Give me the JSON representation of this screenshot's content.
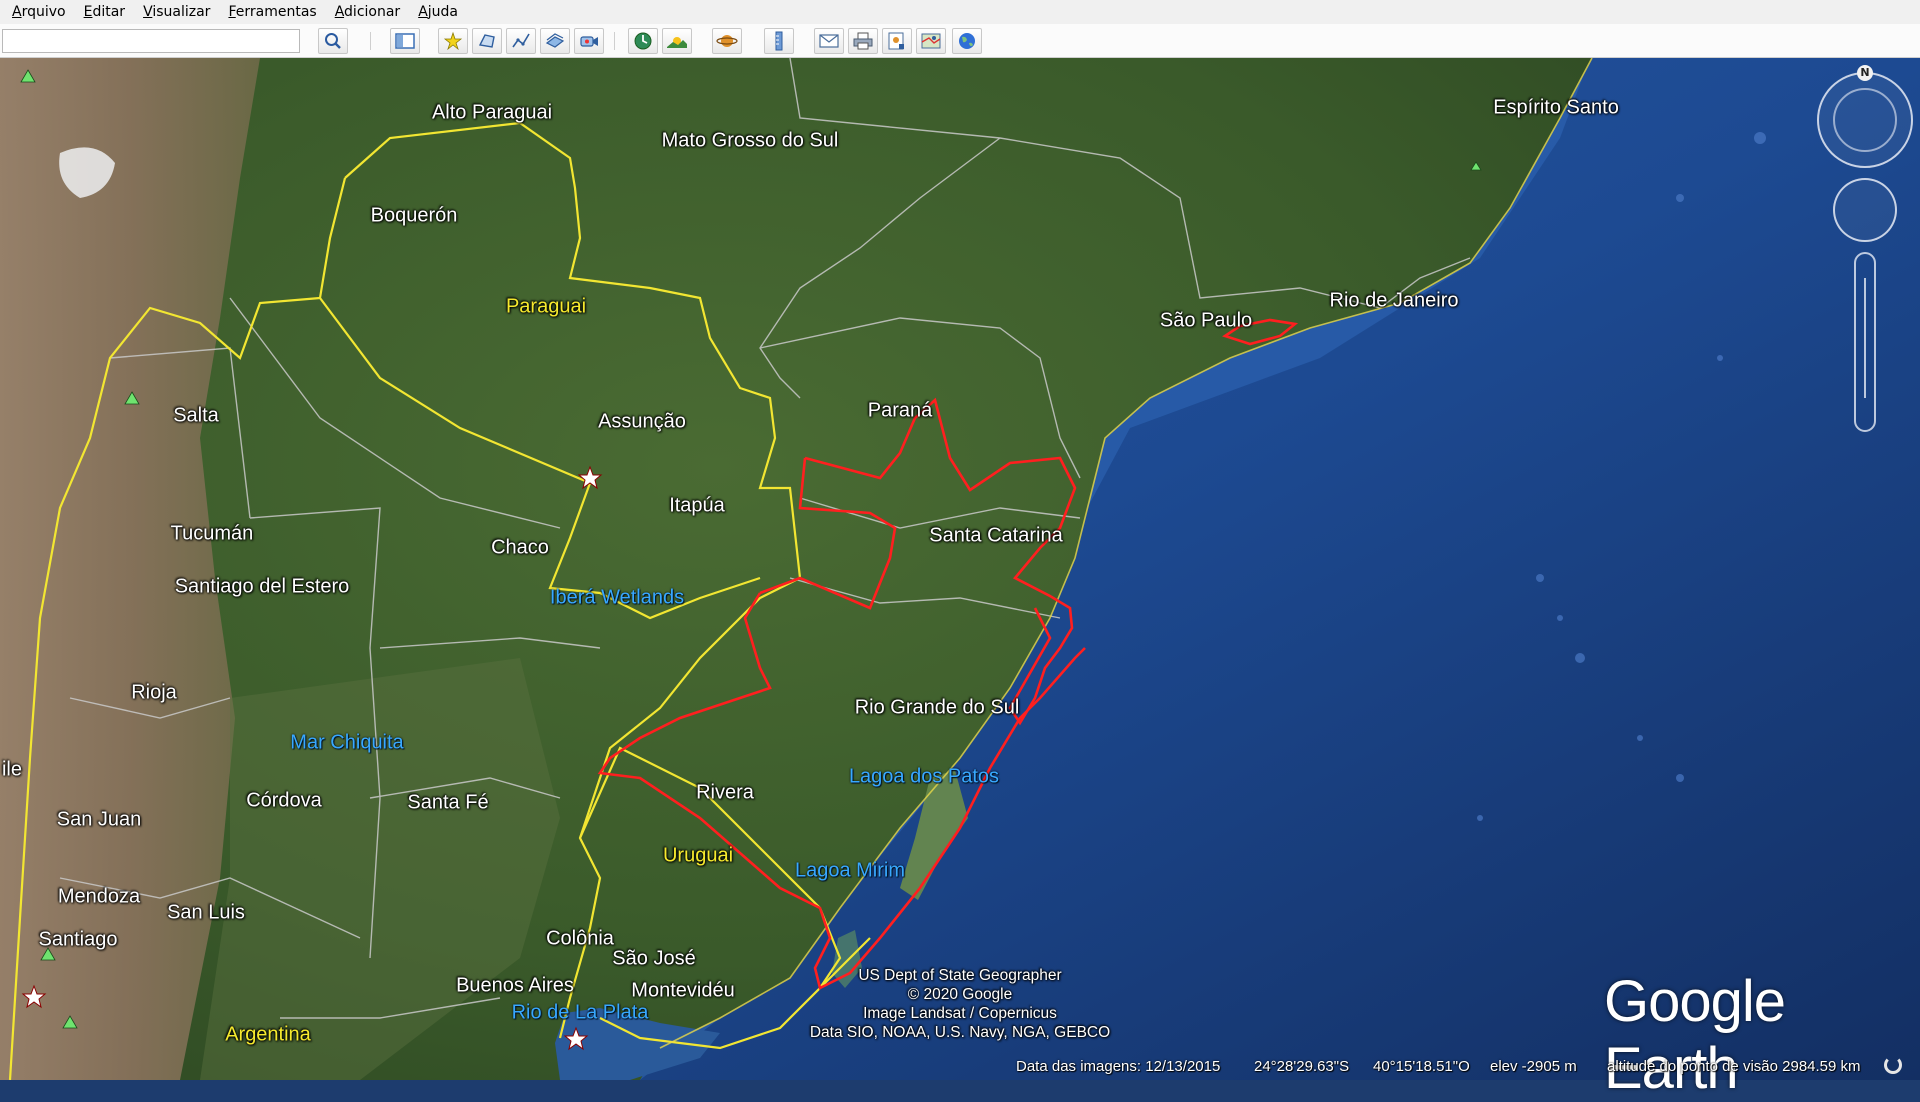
{
  "menu": {
    "items": [
      "Arquivo",
      "Editar",
      "Visualizar",
      "Ferramentas",
      "Adicionar",
      "Ajuda"
    ]
  },
  "toolbar": {
    "search_value": "",
    "search_placeholder": "",
    "buttons": [
      "search-icon",
      "sidebar-toggle-icon",
      "placemark-icon",
      "polygon-icon",
      "path-icon",
      "image-overlay-icon",
      "record-tour-icon",
      "historical-imagery-icon",
      "sunlight-icon",
      "planets-icon",
      "ruler-icon",
      "email-icon",
      "print-icon",
      "save-image-icon",
      "view-in-maps-icon",
      "earth-icon"
    ]
  },
  "colors": {
    "country_border": "#f2e632",
    "state_border": "#c9c9c9",
    "highlight_polygon": "#ff1f1f",
    "ocean": "#1f4f9a",
    "land": "#3a5a2a"
  },
  "map": {
    "countries": [
      {
        "id": "alto-paraguai",
        "text": "Alto Paraguai"
      },
      {
        "id": "boqueron",
        "text": "Boquerón"
      },
      {
        "id": "paraguai",
        "text": "Paraguai"
      },
      {
        "id": "uruguai",
        "text": "Uruguai"
      },
      {
        "id": "argentina",
        "text": "Argentina"
      }
    ],
    "places": [
      {
        "id": "mato-grosso-do-sul",
        "text": "Mato Grosso do Sul"
      },
      {
        "id": "espirito-santo",
        "text": "Espírito Santo"
      },
      {
        "id": "sao-paulo",
        "text": "São Paulo"
      },
      {
        "id": "rio-de-janeiro",
        "text": "Rio de Janeiro"
      },
      {
        "id": "parana",
        "text": "Paraná"
      },
      {
        "id": "assuncao",
        "text": "Assunção"
      },
      {
        "id": "salta",
        "text": "Salta"
      },
      {
        "id": "itapua",
        "text": "Itapúa"
      },
      {
        "id": "santa-catarina",
        "text": "Santa Catarina"
      },
      {
        "id": "chaco",
        "text": "Chaco"
      },
      {
        "id": "tucuman",
        "text": "Tucumán"
      },
      {
        "id": "santiago-del-estero",
        "text": "Santiago del Estero"
      },
      {
        "id": "rioja",
        "text": "Rioja"
      },
      {
        "id": "rio-grande-do-sul",
        "text": "Rio Grande do Sul"
      },
      {
        "id": "cordoba",
        "text": "Córdova"
      },
      {
        "id": "santa-fe",
        "text": "Santa Fé"
      },
      {
        "id": "rivera",
        "text": "Rivera"
      },
      {
        "id": "san-juan",
        "text": "San Juan"
      },
      {
        "id": "mendoza",
        "text": "Mendoza"
      },
      {
        "id": "san-luis",
        "text": "San Luis"
      },
      {
        "id": "santiago",
        "text": "Santiago"
      },
      {
        "id": "colonia",
        "text": "Colônia"
      },
      {
        "id": "sao-jose",
        "text": "São José"
      },
      {
        "id": "buenos-aires",
        "text": "Buenos Aires"
      },
      {
        "id": "montevideu",
        "text": "Montevidéu"
      },
      {
        "id": "chile-partial",
        "text": "ile"
      }
    ],
    "water": [
      {
        "id": "ibera-wetlands",
        "text": "Iberá Wetlands"
      },
      {
        "id": "mar-chiquita",
        "text": "Mar Chiquita"
      },
      {
        "id": "lagoa-dos-patos",
        "text": "Lagoa dos Patos"
      },
      {
        "id": "lagoa-mirim",
        "text": "Lagoa Mirim"
      },
      {
        "id": "rio-de-la-plata",
        "text": "Rio de La Plata"
      }
    ],
    "credits": [
      "US Dept of State Geographer",
      "© 2020 Google",
      "Image Landsat / Copernicus",
      "Data SIO, NOAA, U.S. Navy, NGA, GEBCO"
    ]
  },
  "status": {
    "imagery_date": "Data das imagens: 12/13/2015",
    "latitude": "24°28'29.63\"S",
    "longitude": "40°15'18.51\"O",
    "elevation": "elev -2905 m",
    "eye_altitude": "altitude do ponto de visão 2984.59 km"
  },
  "logo_text": "Google Earth",
  "compass_north": "N"
}
